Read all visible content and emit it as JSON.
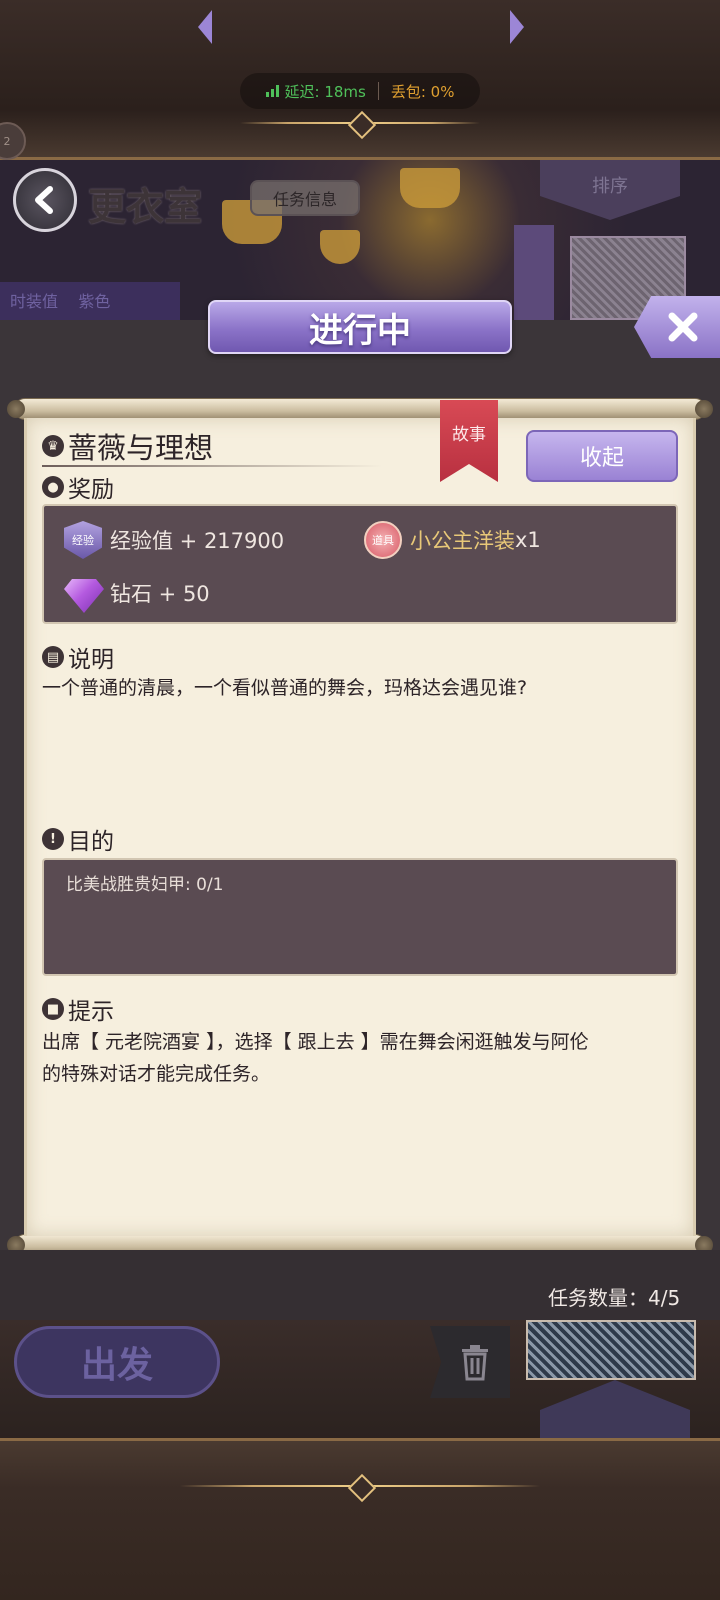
{
  "network": {
    "latency": "延迟: 18ms",
    "packet_loss": "丢包: 0%"
  },
  "header": {
    "side_badge": "2",
    "room_title": "更衣室",
    "task_info_label": "任务信息",
    "sort_label": "排序",
    "left_tag": "时装值",
    "left_tag_color": "紫色"
  },
  "status": {
    "label": "进行中"
  },
  "quest": {
    "title": "蔷薇与理想",
    "category": "故事",
    "collapse_label": "收起",
    "reward_heading": "奖励",
    "rewards": [
      {
        "badge": "经验",
        "label": "经验值 + 217900",
        "icon": "exp-badge-icon"
      },
      {
        "badge": "道具",
        "label": "小公主洋装",
        "qty": "x1",
        "icon": "item-badge-icon"
      },
      {
        "badge": "",
        "label": "钻石 + 50",
        "icon": "diamond-icon"
      }
    ],
    "description_heading": "说明",
    "description": "一个普通的清晨，一个看似普通的舞会，玛格达会遇见谁?",
    "goal_heading": "目的",
    "goal": "比美战胜贵妇甲: 0/1",
    "hint_heading": "提示",
    "hint_line1": "出席【 元老院酒宴 】，选择【 跟上去 】需在舞会闲逛触发与阿伦",
    "hint_line2": "的特殊对话才能完成任务。"
  },
  "footer": {
    "task_count": "任务数量：4/5",
    "depart_label": "出发"
  },
  "colors": {
    "accent": "#8b73c8",
    "parchment": "#f6efde",
    "ribbon": "#d84a55",
    "item_name": "#e8c878"
  }
}
